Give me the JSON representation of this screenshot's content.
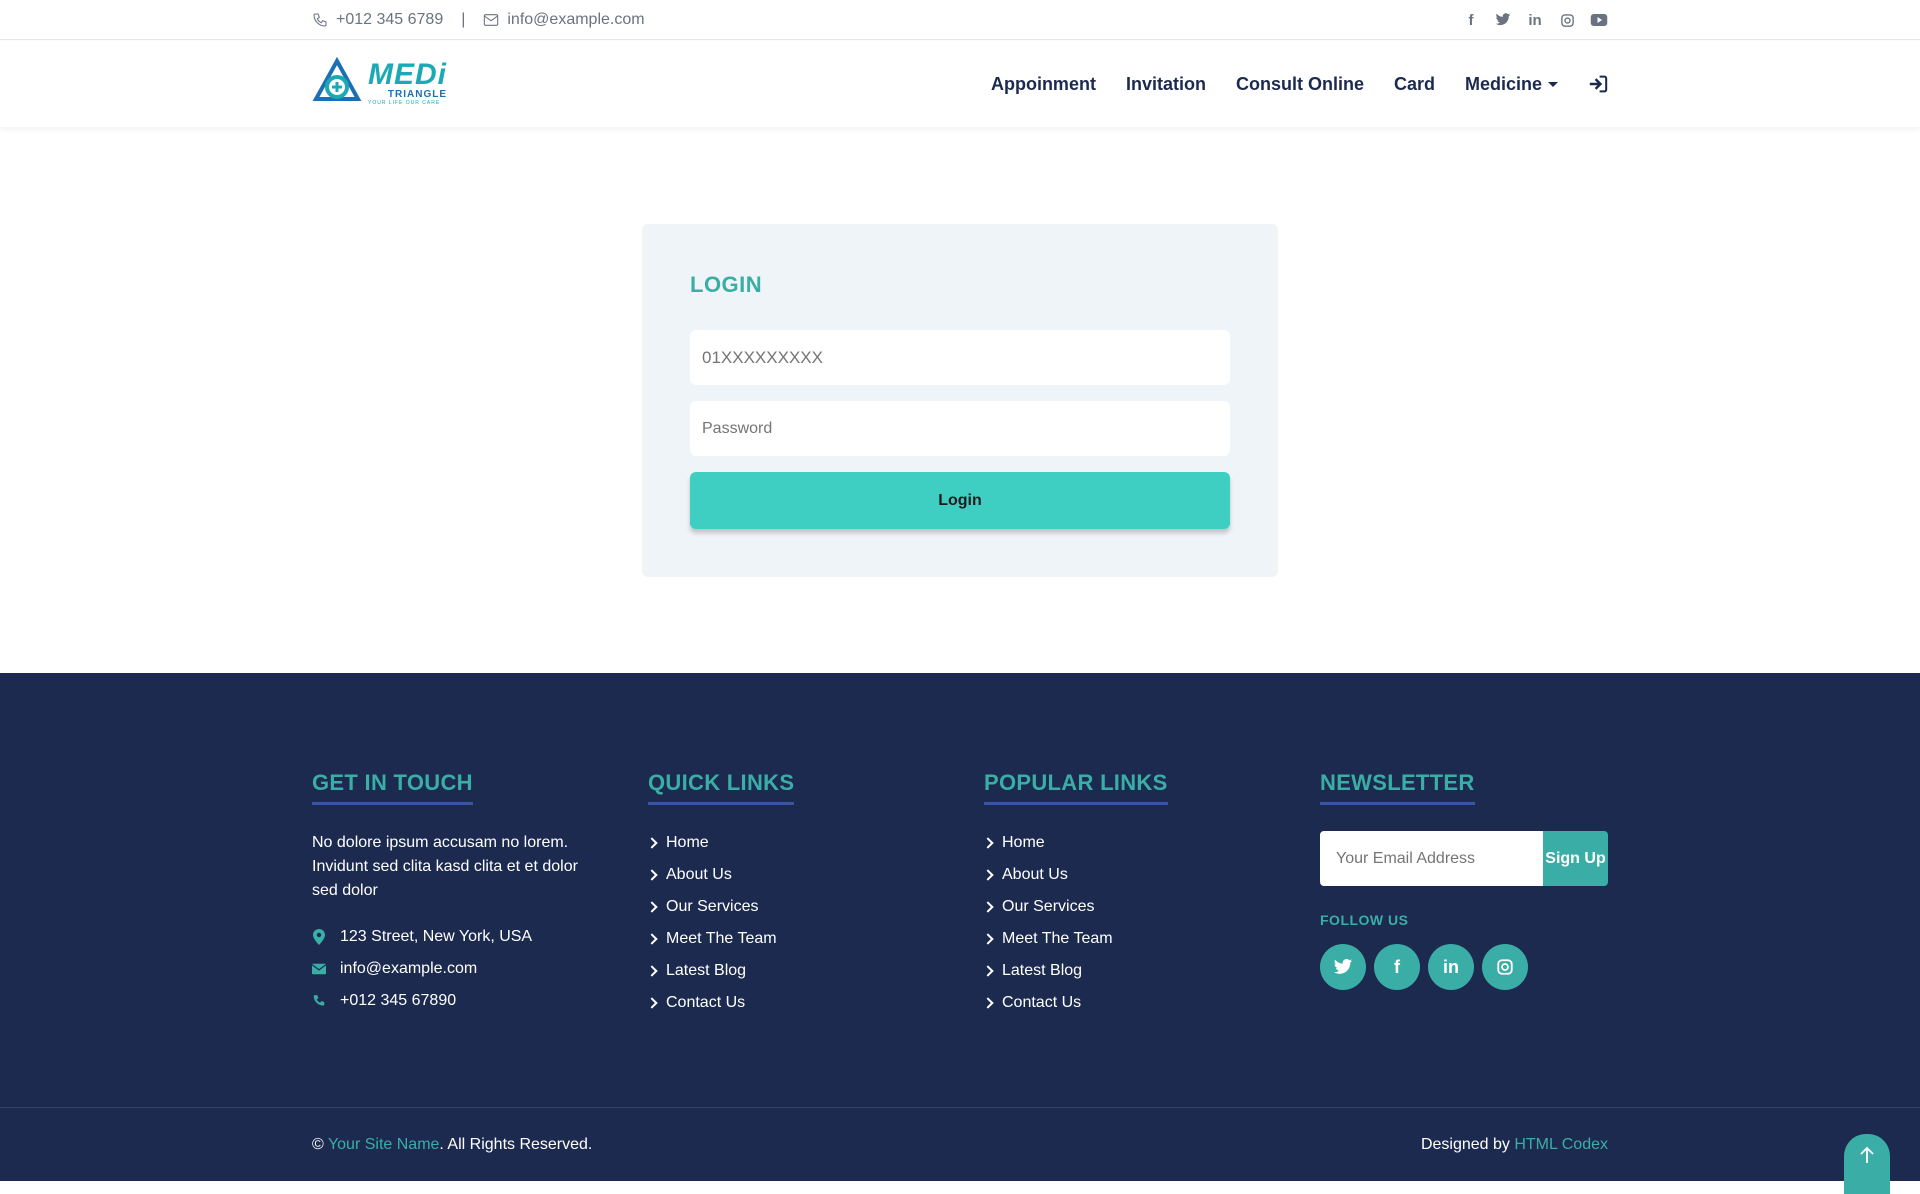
{
  "topbar": {
    "phone": "+012 345 6789",
    "separator": "|",
    "email": "info@example.com",
    "social_icons": [
      "facebook-icon",
      "twitter-icon",
      "linkedin-icon",
      "instagram-icon",
      "youtube-icon"
    ]
  },
  "navbar": {
    "logo_text": "MEDi",
    "logo_sub": "TRIANGLE",
    "logo_tagline": "YOUR LIFE OUR CARE",
    "items": [
      {
        "label": "Appoinment"
      },
      {
        "label": "Invitation"
      },
      {
        "label": "Consult Online"
      },
      {
        "label": "Card"
      },
      {
        "label": "Medicine"
      }
    ]
  },
  "login": {
    "title": "LOGIN",
    "phone_placeholder": "01XXXXXXXXX",
    "password_placeholder": "Password",
    "button_label": "Login"
  },
  "footer": {
    "get_in_touch": {
      "title": "GET IN TOUCH",
      "text": "No dolore ipsum accusam no lorem. Invidunt sed clita kasd clita et et dolor sed dolor",
      "address": "123 Street, New York, USA",
      "email": "info@example.com",
      "phone": "+012 345 67890"
    },
    "quick_links": {
      "title": "QUICK LINKS",
      "items": [
        "Home",
        "About Us",
        "Our Services",
        "Meet The Team",
        "Latest Blog",
        "Contact Us"
      ]
    },
    "popular_links": {
      "title": "POPULAR LINKS",
      "items": [
        "Home",
        "About Us",
        "Our Services",
        "Meet The Team",
        "Latest Blog",
        "Contact Us"
      ]
    },
    "newsletter": {
      "title": "NEWSLETTER",
      "placeholder": "Your Email Address",
      "button_label": "Sign Up",
      "follow_label": "FOLLOW US",
      "social_icons": [
        "twitter-icon",
        "facebook-icon",
        "linkedin-icon",
        "instagram-icon"
      ]
    },
    "bottom": {
      "copyright_symbol": "©",
      "site_name": "Your Site Name",
      "rights": ". All Rights Reserved.",
      "designed_by": "Designed by",
      "designer": "HTML Codex"
    }
  },
  "colors": {
    "accent": "#3aaea6",
    "button": "#3ecfc2",
    "footer_bg": "#1c2a4f",
    "nav_text": "#1c2a4f"
  }
}
